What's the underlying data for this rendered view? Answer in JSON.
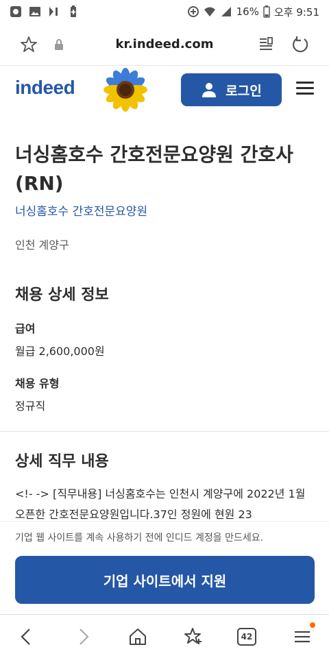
{
  "status_bar": {
    "battery": "16%",
    "time": "오후 9:51"
  },
  "browser": {
    "url": "kr.indeed.com",
    "tab_count": "42"
  },
  "header": {
    "logo": "indeed",
    "login_label": "로그인"
  },
  "job": {
    "title": "너싱홈호수 간호전문요양원 간호사 (RN)",
    "company": "너싱홈호수 간호전문요양원",
    "location": "인천 계양구"
  },
  "details": {
    "heading": "채용 상세 정보",
    "salary_label": "급여",
    "salary_value": "월급 2,600,000원",
    "type_label": "채용 유형",
    "type_value": "정규직"
  },
  "description": {
    "heading": "상세 직무 내용",
    "text": "<!- -> [직무내용] 너싱홈호수는 인천시 계양구에 2022년 1월 오픈한 간호전문요양원입니다.37인 정원에 현원 23"
  },
  "banner": {
    "text": "기업 웹 사이트를 계속 사용하기 전에 인디드 계정을 만드세요.",
    "apply_label": "기업 사이트에서 지원"
  },
  "colors": {
    "brand": "#2557a7",
    "notification": "#ff6a00"
  }
}
